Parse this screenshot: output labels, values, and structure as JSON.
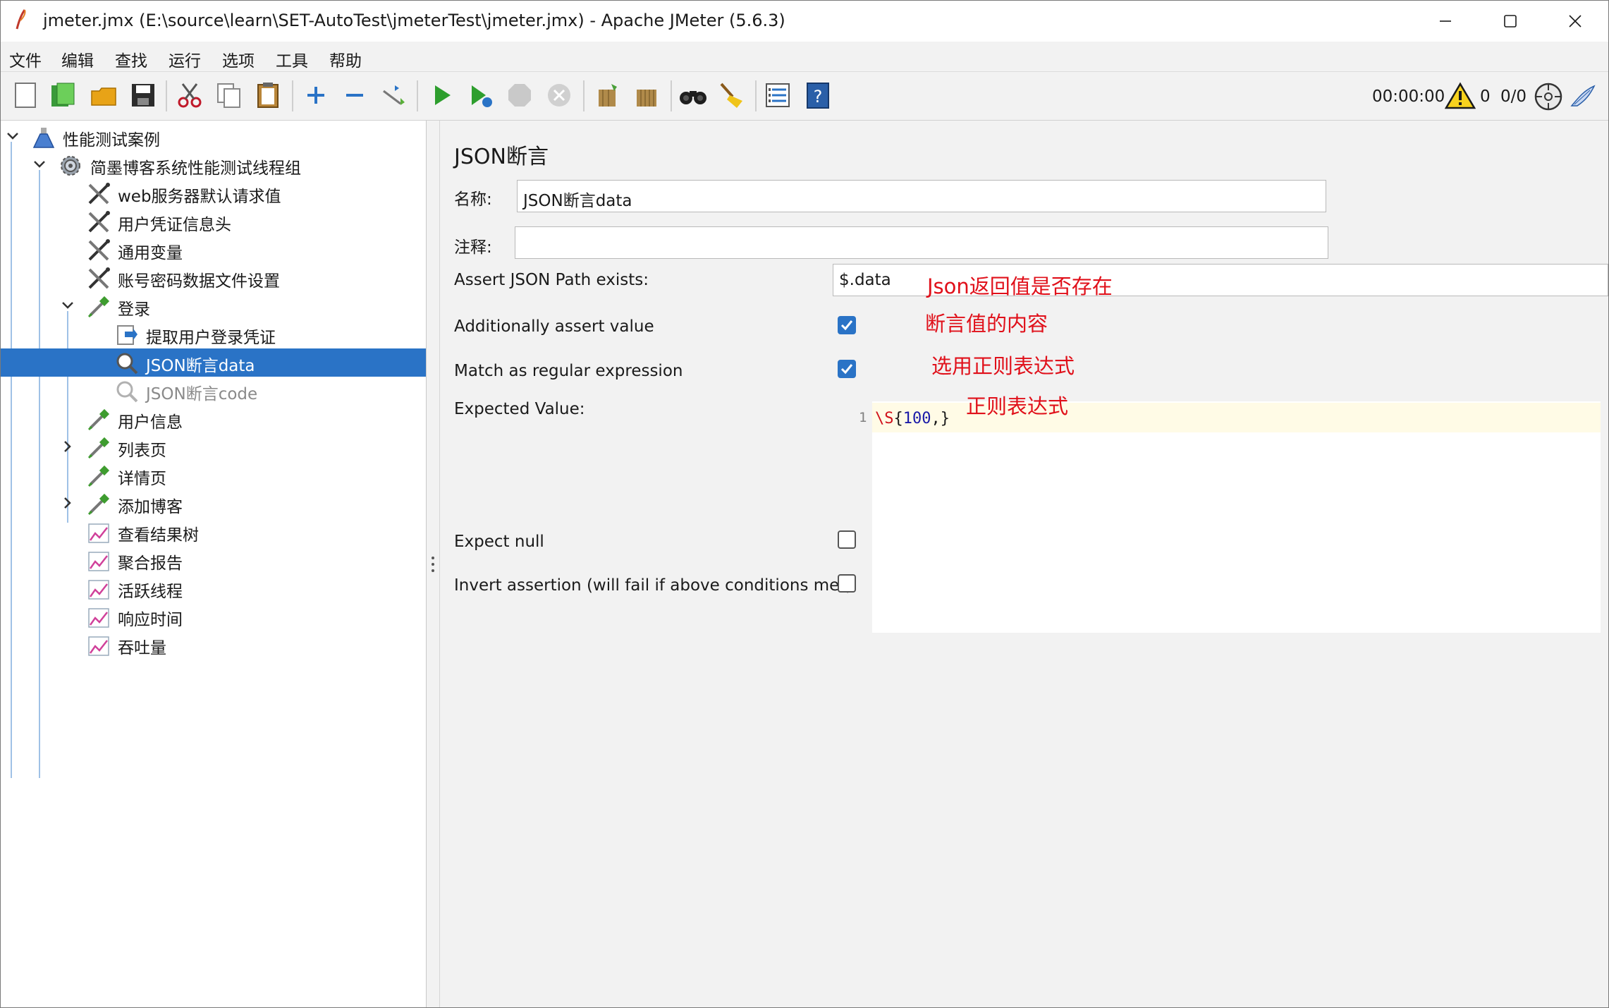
{
  "window": {
    "title": "jmeter.jmx (E:\\source\\learn\\SET-AutoTest\\jmeterTest\\jmeter.jmx) - Apache JMeter (5.6.3)"
  },
  "menu": [
    "文件",
    "编辑",
    "查找",
    "运行",
    "选项",
    "工具",
    "帮助"
  ],
  "status": {
    "elapsed": "00:00:00",
    "errors": "0",
    "threads": "0/0"
  },
  "tree": [
    {
      "label": "性能测试案例",
      "icon": "flask-icon",
      "toggle": "expanded"
    },
    {
      "label": "简墨博客系统性能测试线程组",
      "icon": "gear-icon",
      "toggle": "expanded"
    },
    {
      "label": "web服务器默认请求值",
      "icon": "config-tools-icon"
    },
    {
      "label": "用户凭证信息头",
      "icon": "config-tools-icon"
    },
    {
      "label": "通用变量",
      "icon": "config-tools-icon"
    },
    {
      "label": "账号密码数据文件设置",
      "icon": "config-tools-icon"
    },
    {
      "label": "登录",
      "icon": "sampler-pipette-icon",
      "toggle": "expanded"
    },
    {
      "label": "提取用户登录凭证",
      "icon": "extractor-icon"
    },
    {
      "label": "JSON断言data",
      "icon": "assertion-magnifier-icon",
      "selected": true
    },
    {
      "label": "JSON断言code",
      "icon": "assertion-magnifier-icon",
      "disabled": true
    },
    {
      "label": "用户信息",
      "icon": "sampler-pipette-icon"
    },
    {
      "label": "列表页",
      "icon": "sampler-pipette-icon",
      "toggle": "collapsed"
    },
    {
      "label": "详情页",
      "icon": "sampler-pipette-icon"
    },
    {
      "label": "添加博客",
      "icon": "sampler-pipette-icon",
      "toggle": "collapsed"
    },
    {
      "label": "查看结果树",
      "icon": "listener-graph-icon"
    },
    {
      "label": "聚合报告",
      "icon": "listener-graph-icon"
    },
    {
      "label": "活跃线程",
      "icon": "listener-graph-icon"
    },
    {
      "label": "响应时间",
      "icon": "listener-graph-icon"
    },
    {
      "label": "吞吐量",
      "icon": "listener-graph-icon"
    }
  ],
  "panel": {
    "title": "JSON断言",
    "name_label": "名称:",
    "name_value": "JSON断言data",
    "comment_label": "注释:",
    "comment_value": "",
    "path_label": "Assert JSON Path exists:",
    "path_value": "$.data",
    "assert_value_label": "Additionally assert value",
    "assert_value_checked": true,
    "regex_label": "Match as regular expression",
    "regex_checked": true,
    "expected_label": "Expected Value:",
    "expected_line_no": "1",
    "expected_code": {
      "esc": "\\S",
      "open": "{",
      "num": "100",
      "close": ",}"
    },
    "expect_null_label": "Expect null",
    "expect_null_checked": false,
    "invert_label": "Invert assertion (will fail if above conditions met)",
    "invert_checked": false
  },
  "annotations": {
    "path": "Json返回值是否存在",
    "assert_value": "断言值的内容",
    "regex": "选用正则表达式",
    "expected": "正则表达式"
  }
}
